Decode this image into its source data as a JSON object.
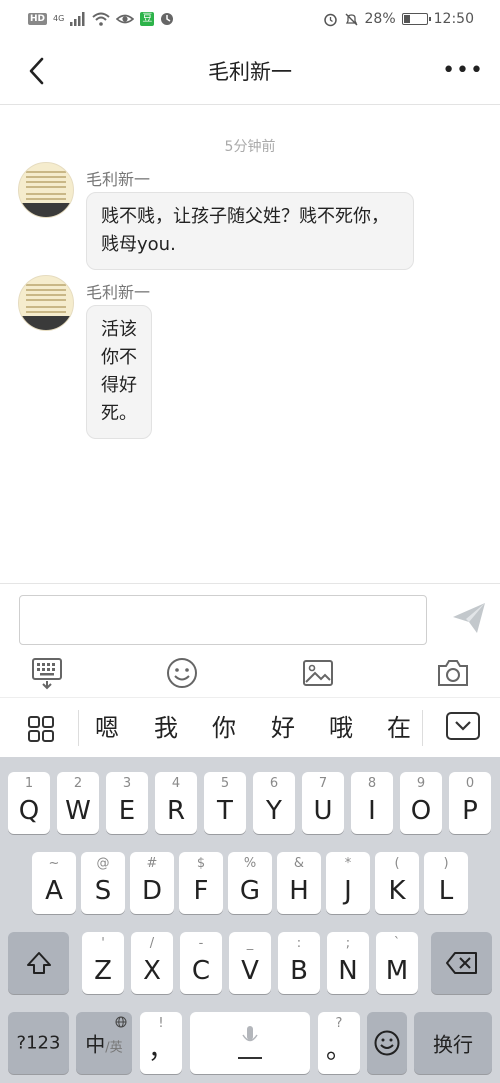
{
  "status_bar": {
    "network": "HD",
    "signal_type": "4G",
    "battery": "28%",
    "battery_fraction": 0.28,
    "time": "12:50",
    "app_badge": "豆"
  },
  "header": {
    "title": "毛利新一",
    "back_icon": "chevron-left-icon",
    "more_icon": "ellipsis-icon",
    "more_label": "•••"
  },
  "chat": {
    "timestamp": "5分钟前",
    "messages": [
      {
        "sender": "毛利新一",
        "text": "贱不贱，让孩子随父姓？贱不死你，贱母you."
      },
      {
        "sender": "毛利新一",
        "text": "活该你不得好死。"
      }
    ]
  },
  "input_bar": {
    "placeholder": "",
    "tools": [
      "keyboard-icon",
      "emoji-icon",
      "image-icon",
      "camera-icon"
    ],
    "send_icon": "send-icon"
  },
  "candidates": {
    "words": [
      "嗯",
      "我",
      "你",
      "好",
      "哦",
      "在"
    ]
  },
  "keyboard": {
    "row1": [
      {
        "letter": "Q",
        "hint": "1"
      },
      {
        "letter": "W",
        "hint": "2"
      },
      {
        "letter": "E",
        "hint": "3"
      },
      {
        "letter": "R",
        "hint": "4"
      },
      {
        "letter": "T",
        "hint": "5"
      },
      {
        "letter": "Y",
        "hint": "6"
      },
      {
        "letter": "U",
        "hint": "7"
      },
      {
        "letter": "I",
        "hint": "8"
      },
      {
        "letter": "O",
        "hint": "9"
      },
      {
        "letter": "P",
        "hint": "0"
      }
    ],
    "row2": [
      {
        "letter": "A",
        "hint": "~"
      },
      {
        "letter": "S",
        "hint": "@"
      },
      {
        "letter": "D",
        "hint": "#"
      },
      {
        "letter": "F",
        "hint": "$"
      },
      {
        "letter": "G",
        "hint": "%"
      },
      {
        "letter": "H",
        "hint": "&"
      },
      {
        "letter": "J",
        "hint": "*"
      },
      {
        "letter": "K",
        "hint": "("
      },
      {
        "letter": "L",
        "hint": ")"
      }
    ],
    "row3": [
      {
        "letter": "Z",
        "hint": "'"
      },
      {
        "letter": "X",
        "hint": "/"
      },
      {
        "letter": "C",
        "hint": "-"
      },
      {
        "letter": "V",
        "hint": "_"
      },
      {
        "letter": "B",
        "hint": ":"
      },
      {
        "letter": "N",
        "hint": ";"
      },
      {
        "letter": "M",
        "hint": "`"
      }
    ],
    "num_key": "?123",
    "lang_key_main": "中",
    "lang_key_sub": "/英",
    "comma_key": "，",
    "comma_hint": "!",
    "period_key": "。",
    "period_hint": "?",
    "enter_key": "换行"
  }
}
